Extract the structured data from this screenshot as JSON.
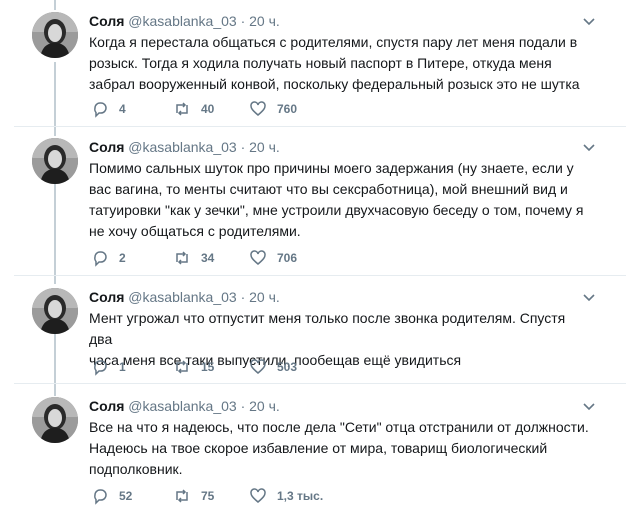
{
  "tweets": [
    {
      "name": "Соля",
      "handle": "@kasablanka_03",
      "dot": "·",
      "time": "20 ч.",
      "text": "Когда я перестала общаться с родителями, спустя пару лет меня подали в\nрозыск. Тогда я ходила получать новый паспорт в Питере, откуда меня\nзабрал вооруженный конвой, поскольку федеральный розыск это не шутка",
      "replies": "4",
      "retweets": "40",
      "likes": "760"
    },
    {
      "name": "Соля",
      "handle": "@kasablanka_03",
      "dot": "·",
      "time": "20 ч.",
      "text": "Помимо сальных шуток про причины моего задержания (ну знаете, если у\nвас вагина, то менты считают что вы сексработница), мой внешний вид и\nтатуировки \"как у зечки\", мне устроили двухчасовую беседу о том, почему я\nне хочу общаться с родителями.",
      "replies": "2",
      "retweets": "34",
      "likes": "706"
    },
    {
      "name": "Соля",
      "handle": "@kasablanka_03",
      "dot": "·",
      "time": "20 ч.",
      "text": "Мент угрожал что отпустит меня только после звонка родителям. Спустя два\nчаса меня все таки выпустили, пообещав ещё увидиться",
      "replies": "1",
      "retweets": "15",
      "likes": "503"
    },
    {
      "name": "Соля",
      "handle": "@kasablanka_03",
      "dot": "·",
      "time": "20 ч.",
      "text": "Все на что я надеюсь, что после дела \"Сети\" отца отстранили от должности.\nНадеюсь на твое скорое избавление от мира, товарищ биологический\nподполковник.",
      "replies": "52",
      "retweets": "75",
      "likes": "1,3 тыс."
    }
  ],
  "icons": {
    "reply": "reply-icon",
    "retweet": "retweet-icon",
    "like": "heart-icon",
    "caret": "chevron-down-icon"
  },
  "colors": {
    "text": "#14171a",
    "muted": "#657786",
    "thread_line": "#c4cfd6",
    "divider": "#e6ecf0"
  }
}
